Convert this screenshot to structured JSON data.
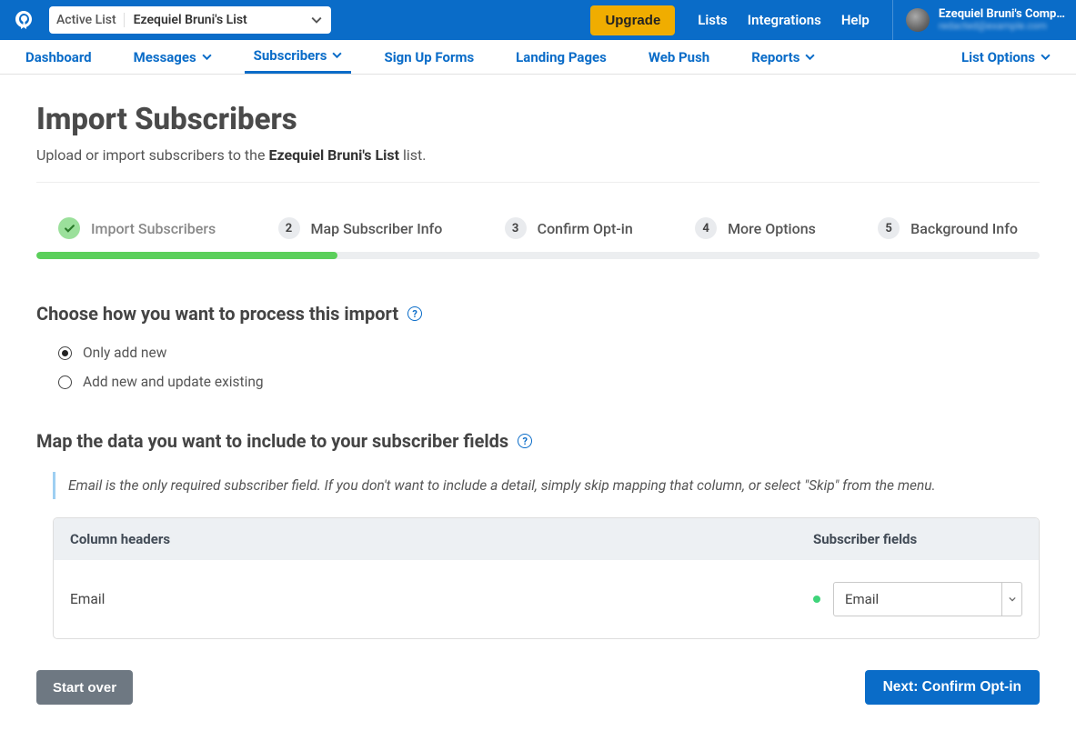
{
  "topbar": {
    "active_list_label": "Active List",
    "list_name": "Ezequiel Bruni's List",
    "upgrade": "Upgrade",
    "links": {
      "lists": "Lists",
      "integrations": "Integrations",
      "help": "Help"
    },
    "account_name": "Ezequiel Bruni's Comp…",
    "account_sub": "redacted@example.com"
  },
  "nav": {
    "dashboard": "Dashboard",
    "messages": "Messages",
    "subscribers": "Subscribers",
    "signup": "Sign Up Forms",
    "landing": "Landing Pages",
    "webpush": "Web Push",
    "reports": "Reports",
    "listoptions": "List Options"
  },
  "page": {
    "title": "Import Subscribers",
    "subtitle_pre": "Upload or import subscribers to the ",
    "subtitle_list": "Ezequiel Bruni's List",
    "subtitle_post": " list."
  },
  "steps": {
    "s1": "Import Subscribers",
    "s2": "Map Subscriber Info",
    "s3": "Confirm Opt-in",
    "s4": "More Options",
    "s5": "Background Info",
    "n2": "2",
    "n3": "3",
    "n4": "4",
    "n5": "5"
  },
  "section1": {
    "heading": "Choose how you want to process this import",
    "opt1": "Only add new",
    "opt2": "Add new and update existing"
  },
  "section2": {
    "heading": "Map the data you want to include to your subscriber fields",
    "info": "Email is the only required subscriber field. If you don't want to include a detail, simply skip mapping that column, or select \"Skip\" from the menu.",
    "col_headers": "Column headers",
    "col_fields": "Subscriber fields",
    "row_header": "Email",
    "row_field": "Email"
  },
  "actions": {
    "startover": "Start over",
    "next": "Next: Confirm Opt-in"
  }
}
